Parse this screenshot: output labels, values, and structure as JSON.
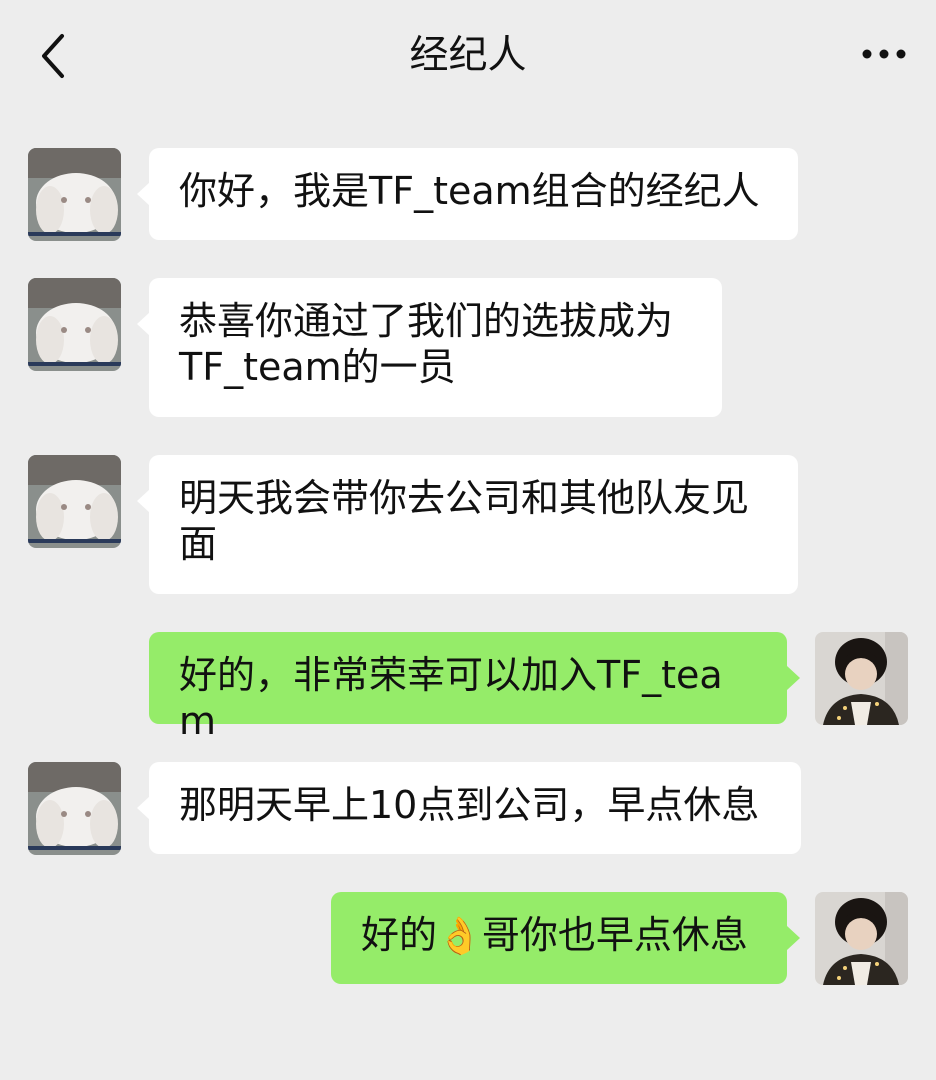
{
  "header": {
    "title": "经纪人",
    "back_icon": "chevron-left-icon",
    "more_icon": "more-horizontal-icon"
  },
  "colors": {
    "background": "#ededed",
    "incoming_bubble": "#ffffff",
    "outgoing_bubble": "#95ec69"
  },
  "messages": [
    {
      "sender": "agent",
      "text": "你好，我是TF_team组合的经纪人"
    },
    {
      "sender": "agent",
      "text": "恭喜你通过了我们的选拔成为TF_team的一员"
    },
    {
      "sender": "agent",
      "text": "明天我会带你去公司和其他队友见面"
    },
    {
      "sender": "me",
      "text": "好的，非常荣幸可以加入TF_team"
    },
    {
      "sender": "agent",
      "text": "那明天早上10点到公司，早点休息"
    },
    {
      "sender": "me",
      "text_before": "好的",
      "emoji": "👌",
      "text_after": "哥你也早点休息"
    }
  ]
}
